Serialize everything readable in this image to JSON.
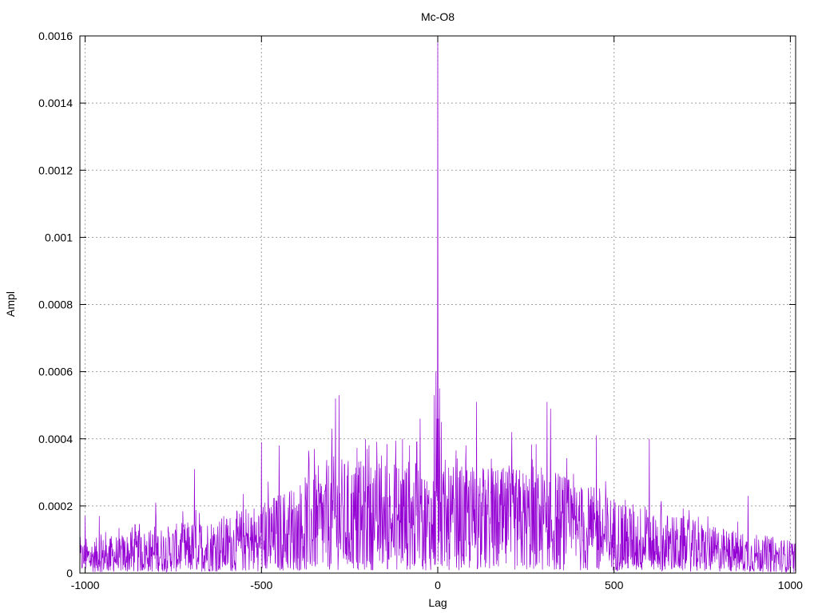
{
  "chart_data": {
    "type": "line",
    "title": "Mc-O8",
    "xlabel": "Lag",
    "ylabel": "Ampl",
    "xlim": [
      -1015,
      1015
    ],
    "ylim": [
      0,
      0.0016
    ],
    "x_ticks": [
      -1000,
      -500,
      0,
      500,
      1000
    ],
    "x_tick_labels": [
      "-1000",
      "-500",
      "0",
      "500",
      "1000"
    ],
    "y_ticks": [
      0,
      0.0002,
      0.0004,
      0.0006,
      0.0008,
      0.001,
      0.0012,
      0.0014,
      0.0016
    ],
    "y_tick_labels": [
      "0",
      "0.0002",
      "0.0004",
      "0.0006",
      "0.0008",
      "0.001",
      "0.0012",
      "0.0014",
      "0.0016"
    ],
    "grid": true,
    "legend": "none",
    "series": [
      {
        "color": "#9400d3",
        "x_start": -1015,
        "x_step": 1,
        "envelope": [
          [
            -1015,
            5e-05
          ],
          [
            -800,
            7e-05
          ],
          [
            -600,
            9e-05
          ],
          [
            -500,
            0.00011
          ],
          [
            -400,
            0.00014
          ],
          [
            -300,
            0.00018
          ],
          [
            -200,
            0.00017
          ],
          [
            -100,
            0.00018
          ],
          [
            -20,
            0.00016
          ],
          [
            0,
            0.00016
          ],
          [
            20,
            0.00016
          ],
          [
            100,
            0.00017
          ],
          [
            200,
            0.00016
          ],
          [
            300,
            0.00017
          ],
          [
            400,
            0.00014
          ],
          [
            500,
            0.00012
          ],
          [
            600,
            0.0001
          ],
          [
            800,
            7e-05
          ],
          [
            1015,
            5e-05
          ]
        ],
        "peaks": [
          [
            -1000,
            0.00017
          ],
          [
            -960,
            0.00017
          ],
          [
            -800,
            0.00021
          ],
          [
            -690,
            0.00031
          ],
          [
            -500,
            0.00039
          ],
          [
            -450,
            0.00038
          ],
          [
            -350,
            0.00037
          ],
          [
            -300,
            0.00043
          ],
          [
            -290,
            0.00052
          ],
          [
            -280,
            0.00053
          ],
          [
            -200,
            0.00037
          ],
          [
            -160,
            0.00035
          ],
          [
            -100,
            0.0004
          ],
          [
            -80,
            0.00038
          ],
          [
            -60,
            0.00039
          ],
          [
            -50,
            0.00046
          ],
          [
            -10,
            0.00053
          ],
          [
            -5,
            0.0006
          ],
          [
            -2,
            0.00046
          ],
          [
            0,
            0.0016
          ],
          [
            2,
            0.00046
          ],
          [
            5,
            0.00055
          ],
          [
            10,
            0.00045
          ],
          [
            80,
            0.00038
          ],
          [
            110,
            0.00051
          ],
          [
            210,
            0.00042
          ],
          [
            310,
            0.00051
          ],
          [
            320,
            0.00049
          ],
          [
            450,
            0.00041
          ],
          [
            600,
            0.0004
          ],
          [
            880,
            0.00023
          ]
        ]
      }
    ]
  }
}
